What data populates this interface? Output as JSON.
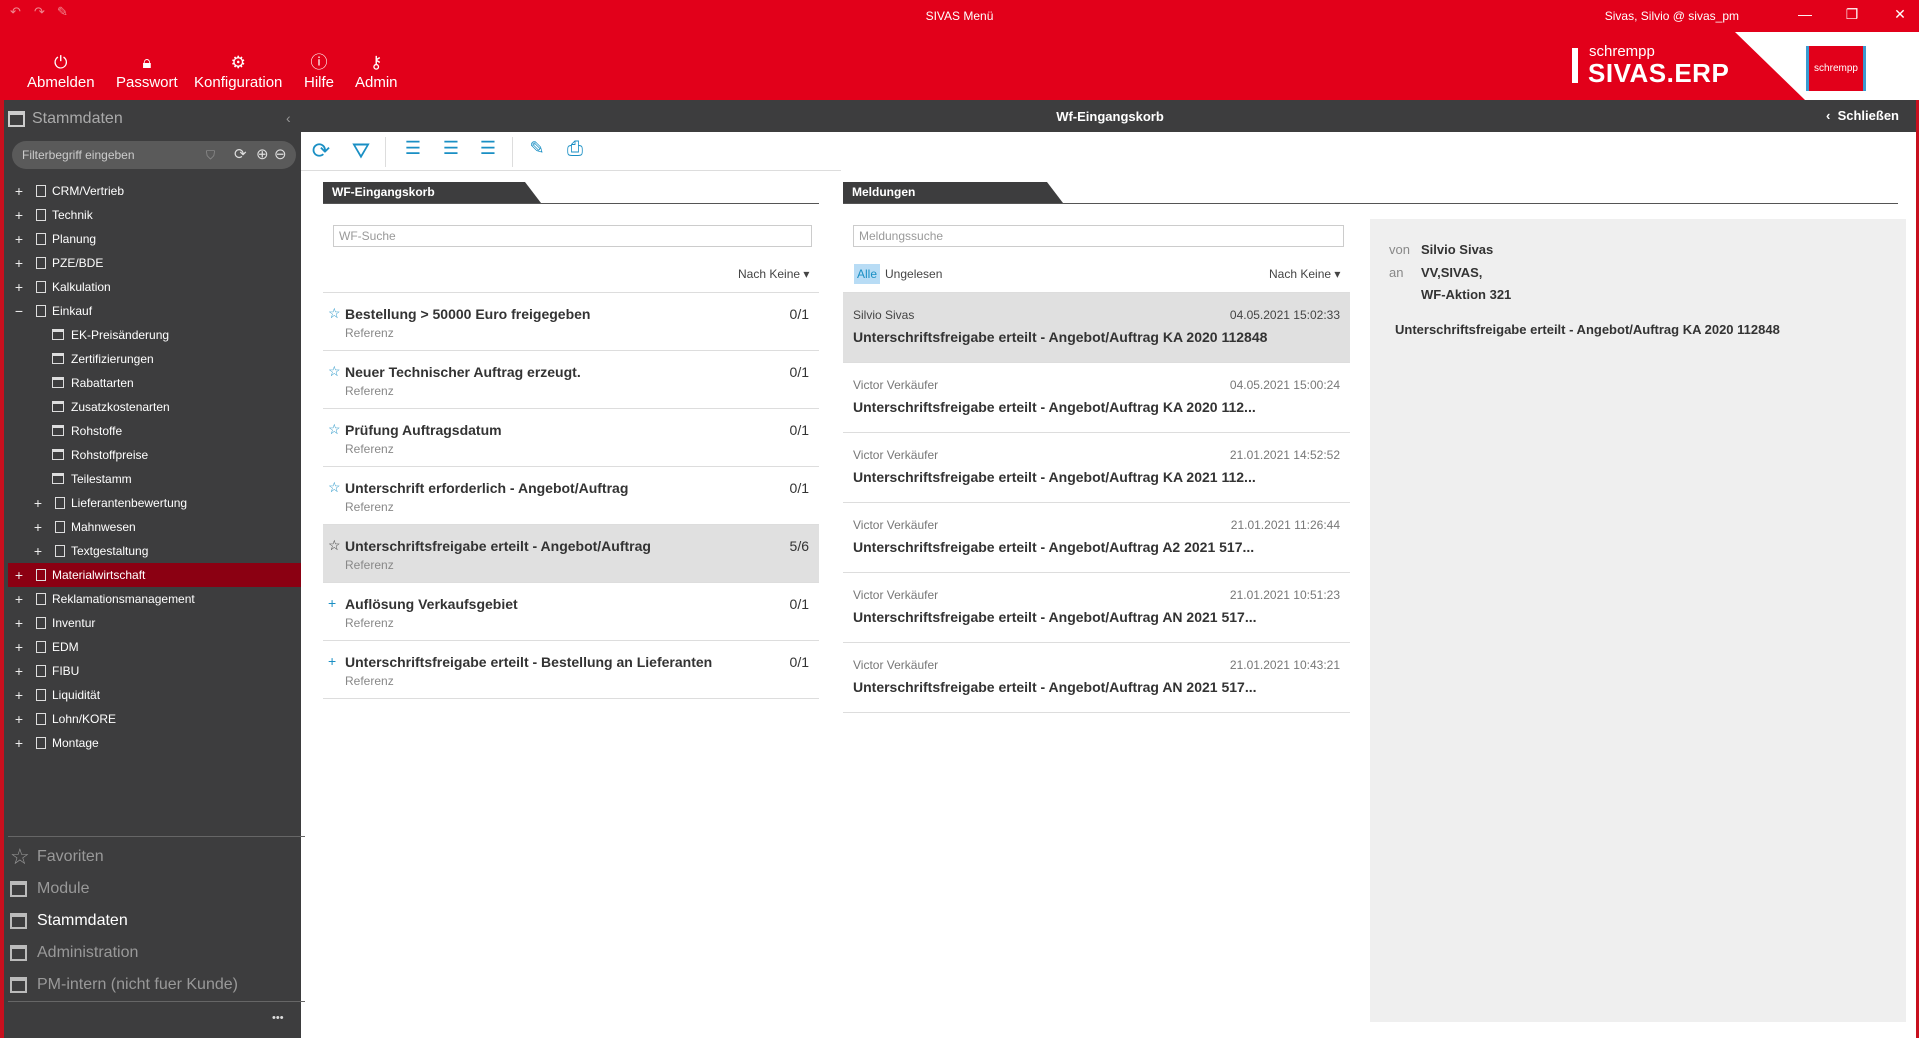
{
  "window": {
    "title": "SIVAS Menü",
    "user": "Sivas, Silvio @ sivas_pm"
  },
  "nav": [
    {
      "label": "Abmelden",
      "icon": "power-icon"
    },
    {
      "label": "Passwort",
      "icon": "lock-icon"
    },
    {
      "label": "Konfiguration",
      "icon": "gear-icon"
    },
    {
      "label": "Hilfe",
      "icon": "help-icon"
    },
    {
      "label": "Admin",
      "icon": "key-icon"
    }
  ],
  "logo": {
    "small": "schrempp",
    "big": "SIVAS.ERP",
    "box": "schrempp"
  },
  "sidebar": {
    "title": "Stammdaten",
    "filter_placeholder": "Filterbegriff eingeben",
    "tree": [
      {
        "label": "CRM/Vertrieb",
        "level": 0,
        "exp": "+"
      },
      {
        "label": "Technik",
        "level": 0,
        "exp": "+"
      },
      {
        "label": "Planung",
        "level": 0,
        "exp": "+"
      },
      {
        "label": "PZE/BDE",
        "level": 0,
        "exp": "+"
      },
      {
        "label": "Kalkulation",
        "level": 0,
        "exp": "+"
      },
      {
        "label": "Einkauf",
        "level": 0,
        "exp": "−"
      },
      {
        "label": "EK-Preisänderung",
        "level": 2
      },
      {
        "label": "Zertifizierungen",
        "level": 2
      },
      {
        "label": "Rabattarten",
        "level": 2
      },
      {
        "label": "Zusatzkostenarten",
        "level": 2
      },
      {
        "label": "Rohstoffe",
        "level": 2
      },
      {
        "label": "Rohstoffpreise",
        "level": 2
      },
      {
        "label": "Teilestamm",
        "level": 2
      },
      {
        "label": "Lieferantenbewertung",
        "level": 1,
        "exp": "+"
      },
      {
        "label": "Mahnwesen",
        "level": 1,
        "exp": "+"
      },
      {
        "label": "Textgestaltung",
        "level": 1,
        "exp": "+"
      },
      {
        "label": "Materialwirtschaft",
        "level": 0,
        "exp": "+",
        "selected": true
      },
      {
        "label": "Reklamationsmanagement",
        "level": 0,
        "exp": "+"
      },
      {
        "label": "Inventur",
        "level": 0,
        "exp": "+"
      },
      {
        "label": "EDM",
        "level": 0,
        "exp": "+"
      },
      {
        "label": "FIBU",
        "level": 0,
        "exp": "+"
      },
      {
        "label": "Liquidität",
        "level": 0,
        "exp": "+"
      },
      {
        "label": "Lohn/KORE",
        "level": 0,
        "exp": "+"
      },
      {
        "label": "Montage",
        "level": 0,
        "exp": "+"
      }
    ],
    "bottom": [
      {
        "label": "Favoriten",
        "icon": "star-icon"
      },
      {
        "label": "Module",
        "icon": "window-icon"
      },
      {
        "label": "Stammdaten",
        "icon": "window-icon",
        "active": true
      },
      {
        "label": "Administration",
        "icon": "window-icon"
      },
      {
        "label": "PM-intern (nicht fuer Kunde)",
        "icon": "window-icon"
      }
    ],
    "more": "•••"
  },
  "header": {
    "title": "Wf-Eingangskorb",
    "close": "Schließen"
  },
  "wf": {
    "tab": "WF-Eingangskorb",
    "search_placeholder": "WF-Suche",
    "sort": "Nach Keine ▾",
    "rows": [
      {
        "title": "Bestellung > 50000 Euro freigegeben",
        "ref": "Referenz",
        "count": "0/1",
        "icon": "star"
      },
      {
        "title": "Neuer Technischer Auftrag erzeugt.",
        "ref": "Referenz",
        "count": "0/1",
        "icon": "star"
      },
      {
        "title": "Prüfung Auftragsdatum",
        "ref": "Referenz",
        "count": "0/1",
        "icon": "star"
      },
      {
        "title": "Unterschrift erforderlich - Angebot/Auftrag",
        "ref": "Referenz",
        "count": "0/1",
        "icon": "star"
      },
      {
        "title": "Unterschriftsfreigabe erteilt - Angebot/Auftrag",
        "ref": "Referenz",
        "count": "5/6",
        "icon": "star",
        "selected": true
      },
      {
        "title": "Auflösung Verkaufsgebiet",
        "ref": "Referenz",
        "count": "0/1",
        "icon": "plus"
      },
      {
        "title": "Unterschriftsfreigabe erteilt - Bestellung an Lieferanten",
        "ref": "Referenz",
        "count": "0/1",
        "icon": "plus"
      }
    ]
  },
  "msg": {
    "tab": "Meldungen",
    "search_placeholder": "Meldungssuche",
    "filter_all": "Alle",
    "filter_unread": "Ungelesen",
    "sort": "Nach Keine ▾",
    "rows": [
      {
        "sender": "Silvio Sivas",
        "date": "04.05.2021 15:02:33",
        "title": "Unterschriftsfreigabe erteilt - Angebot/Auftrag KA 2020 112848",
        "selected": true
      },
      {
        "sender": "Victor Verkäufer",
        "date": "04.05.2021 15:00:24",
        "title": "Unterschriftsfreigabe erteilt - Angebot/Auftrag KA 2020 112..."
      },
      {
        "sender": "Victor Verkäufer",
        "date": "21.01.2021 14:52:52",
        "title": "Unterschriftsfreigabe erteilt - Angebot/Auftrag KA 2021 112..."
      },
      {
        "sender": "Victor Verkäufer",
        "date": "21.01.2021 11:26:44",
        "title": "Unterschriftsfreigabe erteilt - Angebot/Auftrag A2 2021 517..."
      },
      {
        "sender": "Victor Verkäufer",
        "date": "21.01.2021 10:51:23",
        "title": "Unterschriftsfreigabe erteilt - Angebot/Auftrag AN 2021 517..."
      },
      {
        "sender": "Victor Verkäufer",
        "date": "21.01.2021 10:43:21",
        "title": "Unterschriftsfreigabe erteilt - Angebot/Auftrag AN 2021 517..."
      }
    ]
  },
  "detail": {
    "from_label": "von",
    "from": "Silvio Sivas",
    "to_label": "an",
    "to1": "VV,SIVAS,",
    "to2": "WF-Aktion 321",
    "subject": "Unterschriftsfreigabe erteilt - Angebot/Auftrag KA 2020 112848"
  },
  "colors": {
    "brand": "#e2001a",
    "accent": "#1a8fc4",
    "dark": "#3d3d3e",
    "selected_tree": "#8b0012"
  }
}
